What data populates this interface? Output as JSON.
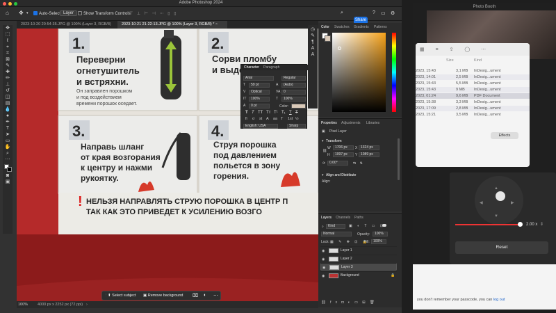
{
  "app": {
    "title": "Adobe Photoshop 2024",
    "share_label": "Share"
  },
  "options_bar": {
    "auto_select_label": "Auto-Select:",
    "auto_select_value": "Layer",
    "transform_controls_label": "Show Transform Controls"
  },
  "doc_tabs": [
    {
      "label": "2023-10-20 20-54-35.JPG @ 100% (Layer 3, RGB/8)"
    },
    {
      "label": "2023-10-21 21-22-13.JPG @ 100% (Layer 3, RGB/8) *"
    }
  ],
  "canvas_text": {
    "step1_num": "1.",
    "step1_line1": "Переверни",
    "step1_line2": "огнетушитель",
    "step1_line3": "и встряхни.",
    "step1_small1": "Он заправлен порошком",
    "step1_small2": "и под воздействием",
    "step1_small3": "времени порошок оседает.",
    "step2_num": "2.",
    "step2_line1": "Сорви пломбу",
    "step2_line2": "и выде",
    "step3_num": "3.",
    "step3_line1": "Направь шланг",
    "step3_line2": "от края возгорания",
    "step3_line3": "к центру и нажми",
    "step3_line4": "рукоятку.",
    "step4_num": "4.",
    "step4_line1": "Струя порошка",
    "step4_line2": "под давлением",
    "step4_line3": "польется в зону",
    "step4_line4": "горения.",
    "warn_mark": "!",
    "warn_line1": "НЕЛЬЗЯ НАПРАВЛЯТЬ СТРУЮ ПОРОШКА В ЦЕНТР П",
    "warn_line2": "ТАК КАК ЭТО ПРИВЕДЕТ К УСИЛЕНИЮ ВОЗГО"
  },
  "contextual_bar": {
    "select_subject": "Select subject",
    "remove_background": "Remove background"
  },
  "status": {
    "zoom": "100%",
    "doc_size": "4000 px x 2252 px (72 ppi)"
  },
  "character_panel": {
    "tabs": [
      "Character",
      "Paragraph"
    ],
    "font_family": "Arial",
    "font_style": "Regular",
    "size": "59 pt",
    "leading": "(Auto)",
    "kerning": "Optical",
    "tracking": "0",
    "vscale": "100%",
    "hscale": "100%",
    "baseline": "0 pt",
    "color_label": "Color:",
    "language": "English: USA",
    "aa": "Sharp",
    "glyph_buttons": [
      "T",
      "T",
      "TT",
      "Tт",
      "T¹",
      "T₁",
      "T",
      "T"
    ],
    "feature_buttons": [
      "fi",
      "σ",
      "st",
      "A",
      "aa",
      "T",
      "1st",
      "½"
    ]
  },
  "color_panel": {
    "tabs": [
      "Color",
      "Swatches",
      "Gradients",
      "Patterns"
    ]
  },
  "properties_panel": {
    "tabs": [
      "Properties",
      "Adjustments",
      "Libraries"
    ],
    "kind": "Pixel Layer",
    "transform_label": "Transform",
    "w": "1706 px",
    "h": "1097 px",
    "x": "1324 px",
    "y": "1089 px",
    "angle": "0.00°",
    "align_label": "Align and Distribute",
    "align_sub": "Align:"
  },
  "layers_panel": {
    "tabs": [
      "Layers",
      "Channels",
      "Paths"
    ],
    "kind_label": "Kind",
    "blend_mode": "Normal",
    "opacity_label": "Opacity:",
    "opacity": "100%",
    "lock_label": "Lock:",
    "fill_label": "Fill:",
    "fill": "100%",
    "layers": [
      {
        "name": "Layer 1"
      },
      {
        "name": "Layer 2"
      },
      {
        "name": "Layer 3"
      },
      {
        "name": "Background"
      }
    ]
  },
  "photo_booth": {
    "title": "Photo Booth",
    "finder_headers": [
      "Size",
      "Kind"
    ],
    "finder_rows": [
      {
        "date": "2023, 15:43",
        "size": "3,1 MB",
        "kind": "InDesig...ument"
      },
      {
        "date": "2023, 14:01",
        "size": "2,5 MB",
        "kind": "InDesig...ument"
      },
      {
        "date": "2023, 15:43",
        "size": "5,5 MB",
        "kind": "InDesig...ument"
      },
      {
        "date": "2023, 15:43",
        "size": "9 MB",
        "kind": "InDesig...ument"
      },
      {
        "date": "2023, 01:24",
        "size": "9,6 MB",
        "kind": "PDF Document"
      },
      {
        "date": "2023, 15:38",
        "size": "3,3 MB",
        "kind": "InDesig...ument"
      },
      {
        "date": "2023, 17:09",
        "size": "2,8 MB",
        "kind": "InDesig...ument"
      },
      {
        "date": "2023, 15:21",
        "size": "3,5 MB",
        "kind": "InDesig...ument"
      }
    ],
    "effects_label": "Effects",
    "speed": "2.00 x",
    "reset_label": "Reset",
    "bottom_text": "you don't remember your passcode, you can",
    "logout_link": "log out"
  }
}
